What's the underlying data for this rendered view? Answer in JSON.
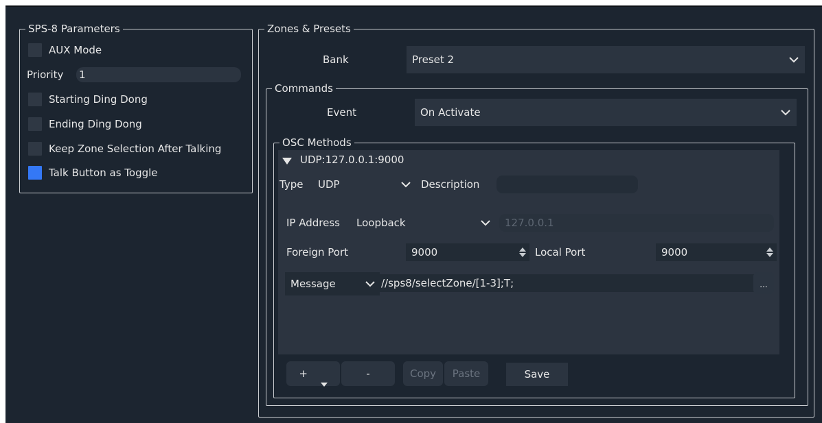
{
  "sps8": {
    "title": "SPS-8 Parameters",
    "aux_mode": {
      "label": "AUX Mode",
      "checked": false
    },
    "priority": {
      "label": "Priority",
      "value": "1"
    },
    "starting_ding_dong": {
      "label": "Starting Ding Dong",
      "checked": false
    },
    "ending_ding_dong": {
      "label": "Ending Ding Dong",
      "checked": false
    },
    "keep_zone_selection": {
      "label": "Keep Zone Selection After Talking",
      "checked": false
    },
    "talk_toggle": {
      "label": "Talk Button as Toggle",
      "checked": true
    }
  },
  "zones": {
    "title": "Zones & Presets",
    "bank_label": "Bank",
    "bank_value": "Preset 2",
    "commands": {
      "title": "Commands",
      "event_label": "Event",
      "event_value": "On Activate",
      "osc": {
        "title": "OSC Methods",
        "entry_title": "UDP:127.0.0.1:9000",
        "type_label": "Type",
        "type_value": "UDP",
        "description_label": "Description",
        "description_value": "",
        "ip_label": "IP Address",
        "ip_mode": "Loopback",
        "ip_value": "127.0.0.1",
        "foreign_port_label": "Foreign Port",
        "foreign_port_value": "9000",
        "local_port_label": "Local Port",
        "local_port_value": "9000",
        "message_type": "Message",
        "message_value": "//sps8/selectZone/[1-3];T;",
        "more_label": "...",
        "buttons": {
          "add": "+",
          "remove": "-",
          "copy": "Copy",
          "paste": "Paste",
          "save": "Save"
        }
      }
    }
  },
  "colors": {
    "background": "#1c2530",
    "accent": "#3478f6",
    "field": "#2b3440"
  }
}
